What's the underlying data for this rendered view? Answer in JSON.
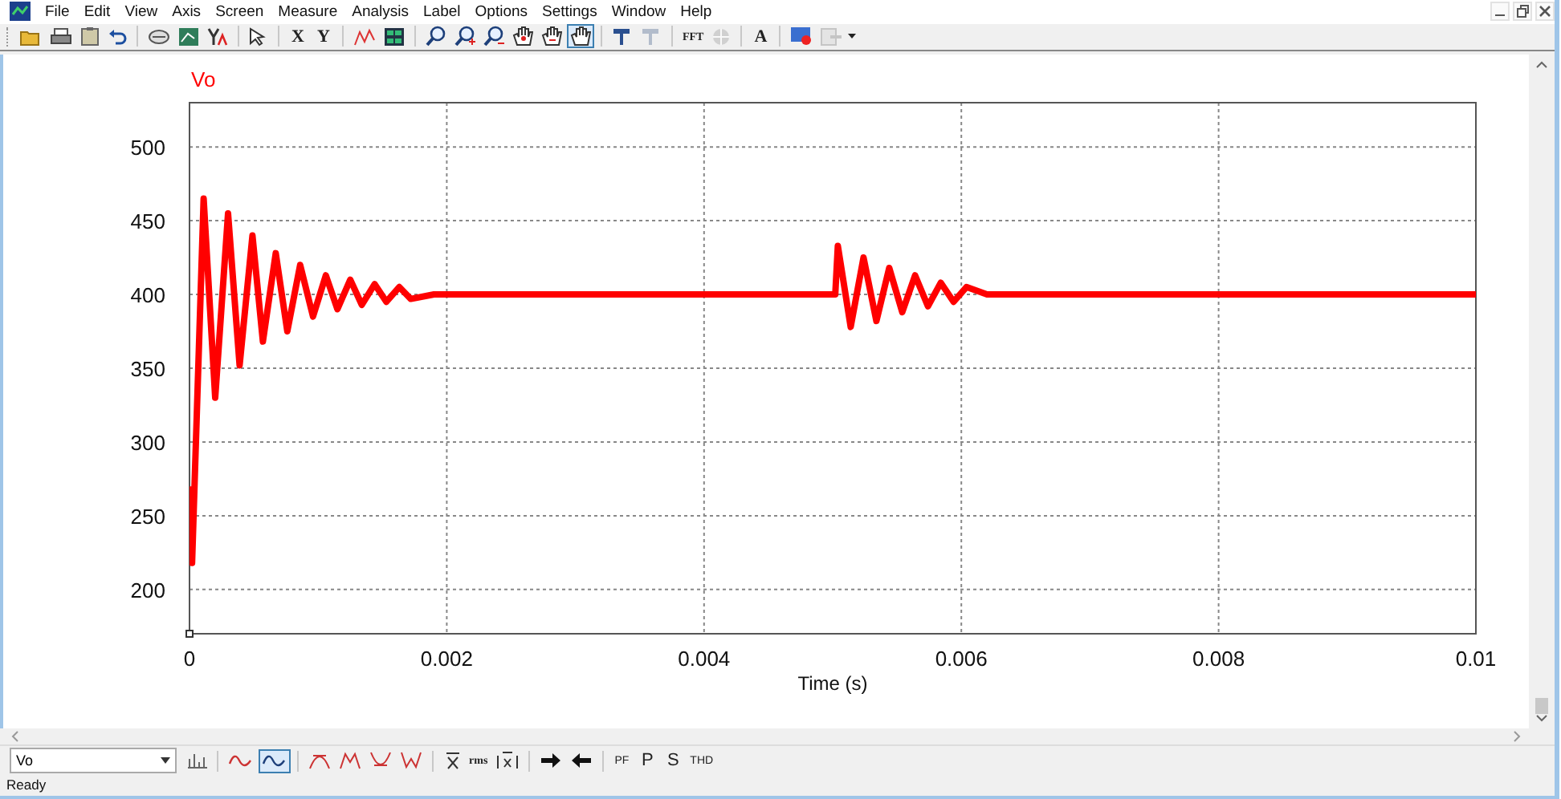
{
  "menu_bar": [
    "File",
    "Edit",
    "View",
    "Axis",
    "Screen",
    "Measure",
    "Analysis",
    "Label",
    "Options",
    "Settings",
    "Window",
    "Help"
  ],
  "toolbar": {
    "axis_buttons": [
      "X",
      "Y"
    ],
    "view_tools": [
      {
        "selected": false
      },
      {
        "selected": false
      },
      {
        "selected": false
      },
      {
        "selected": false
      },
      {
        "selected": false
      },
      {
        "selected": true
      }
    ],
    "fft_button": "FFT",
    "label_button": "A"
  },
  "plot": {
    "chart_data": {
      "type": "line",
      "grid": true,
      "xlabel": "Time (s)",
      "xlim": [
        0,
        0.01
      ],
      "ylim": [
        170,
        530
      ],
      "xticks": [
        {
          "value": 0,
          "label": "0"
        },
        {
          "value": 0.002,
          "label": "0.002"
        },
        {
          "value": 0.004,
          "label": "0.004"
        },
        {
          "value": 0.006,
          "label": "0.006"
        },
        {
          "value": 0.008,
          "label": "0.008"
        },
        {
          "value": 0.01,
          "label": "0.01"
        }
      ],
      "yticks": [
        200,
        250,
        300,
        350,
        400,
        450,
        500
      ],
      "series": [
        {
          "name": "Vo",
          "color": "#ff0000",
          "x": [
            0,
            2e-05,
            0.00011,
            0.0002,
            0.0003,
            0.00039,
            0.00049,
            0.00057,
            0.00067,
            0.00076,
            0.00086,
            0.00096,
            0.00106,
            0.00115,
            0.00125,
            0.00134,
            0.00144,
            0.00153,
            0.00163,
            0.00172,
            0.0019,
            0.005,
            0.00502,
            0.00504,
            0.00514,
            0.00524,
            0.00534,
            0.00544,
            0.00554,
            0.00564,
            0.00574,
            0.00584,
            0.00594,
            0.00604,
            0.0062,
            0.01
          ],
          "values": [
            270,
            218,
            465,
            330,
            455,
            352,
            440,
            368,
            428,
            375,
            420,
            385,
            413,
            390,
            410,
            393,
            407,
            395,
            405,
            397,
            400,
            400,
            400,
            433,
            378,
            425,
            382,
            418,
            388,
            413,
            392,
            408,
            395,
            405,
            400,
            400
          ]
        }
      ]
    }
  },
  "bottom_toolbar": {
    "curve_select": "Vo",
    "waveform_tools": [
      {
        "selected": false
      },
      {
        "selected": true
      }
    ],
    "measure_button": "rms",
    "power_buttons": [
      "PF",
      "P",
      "S",
      "THD"
    ]
  },
  "status_bar": "Ready"
}
